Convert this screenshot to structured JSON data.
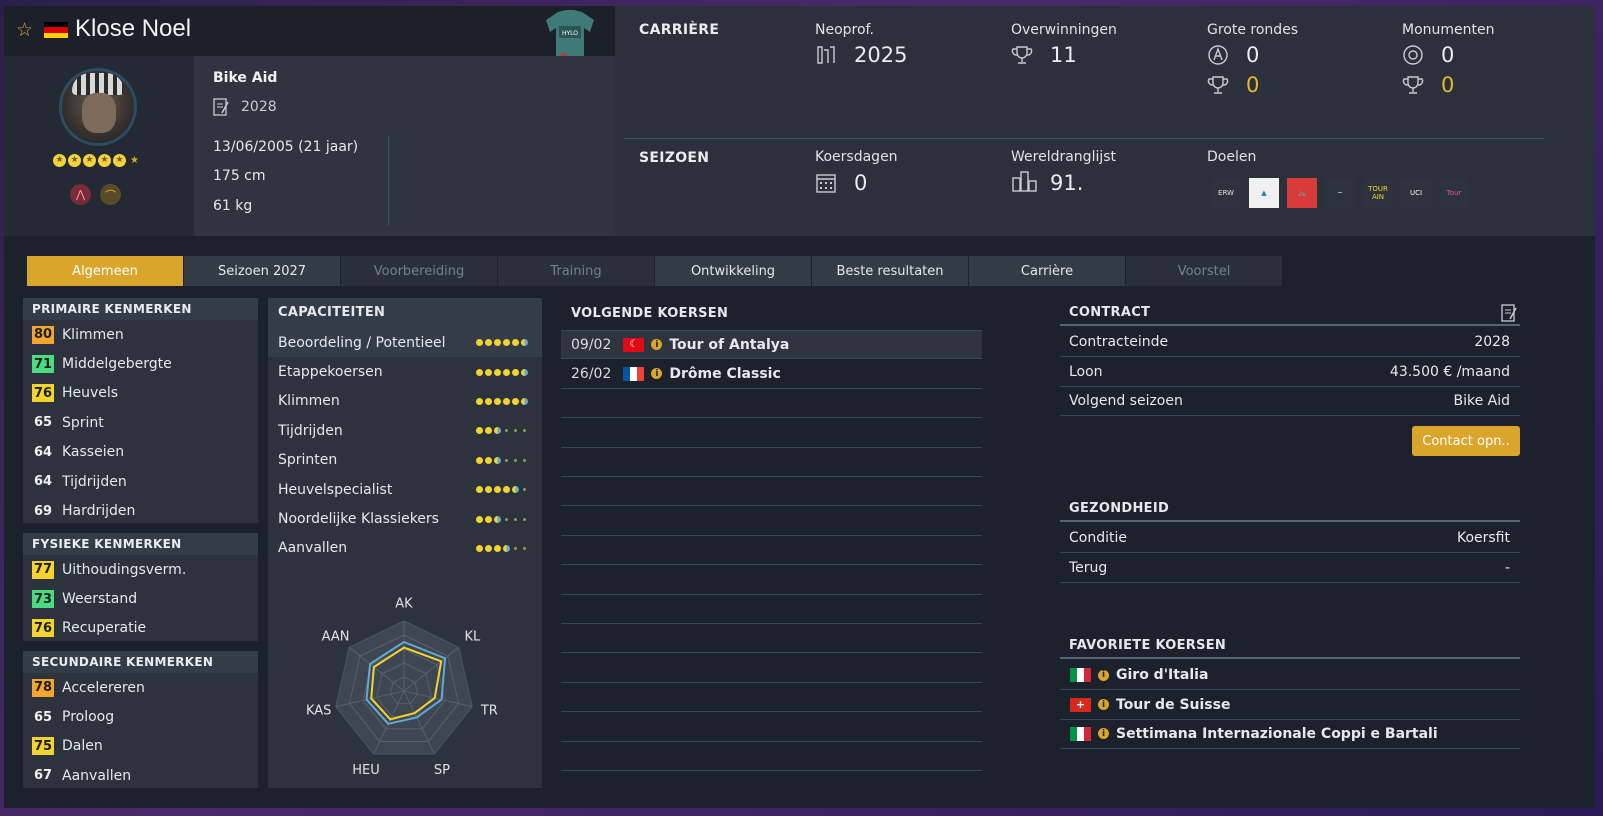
{
  "rider": {
    "name": "Klose Noel",
    "team": "Bike Aid",
    "contract_year": "2028",
    "birthdate": "13/06/2005 (21 jaar)",
    "height": "175 cm",
    "weight": "61 kg",
    "stars_full": 5,
    "stars_half": 1
  },
  "career": {
    "label": "CARRIÈRE",
    "neoprof_label": "Neoprof.",
    "neoprof_value": "2025",
    "wins_label": "Overwinningen",
    "wins_value": "11",
    "grand_tours_label": "Grote rondes",
    "grand_tours_starts": "0",
    "grand_tours_wins": "0",
    "monuments_label": "Monumenten",
    "monuments_starts": "0",
    "monuments_wins": "0"
  },
  "season": {
    "label": "SEIZOEN",
    "race_days_label": "Koersdagen",
    "race_days_value": "0",
    "ranking_label": "Wereldranglijst",
    "ranking_value": "91.",
    "goals_label": "Doelen",
    "goal_logos": [
      {
        "text": "ERW",
        "bg": "#2c333d",
        "color": "#e0e0e0"
      },
      {
        "text": "▲",
        "bg": "#f0f0f0",
        "color": "#1b7fb3"
      },
      {
        "text": "🚲",
        "bg": "#d93a3a",
        "color": "#fff"
      },
      {
        "text": "~",
        "bg": "#2c333d",
        "color": "#e0e0e0"
      },
      {
        "text": "TOUR AIN",
        "bg": "#2c333d",
        "color": "#f3d42e"
      },
      {
        "text": "UCI",
        "bg": "#2c333d",
        "color": "#fff"
      },
      {
        "text": "Tour",
        "bg": "#2c333d",
        "color": "#e05a8a"
      }
    ]
  },
  "tabs": [
    {
      "label": "Algemeen",
      "state": "active"
    },
    {
      "label": "Seizoen 2027",
      "state": "normal"
    },
    {
      "label": "Voorbereiding",
      "state": "disabled"
    },
    {
      "label": "Training",
      "state": "disabled"
    },
    {
      "label": "Ontwikkeling",
      "state": "normal"
    },
    {
      "label": "Beste resultaten",
      "state": "normal"
    },
    {
      "label": "Carrière",
      "state": "normal"
    },
    {
      "label": "Voorstel",
      "state": "disabled"
    }
  ],
  "primary": {
    "title": "PRIMAIRE KENMERKEN",
    "items": [
      {
        "value": "80",
        "label": "Klimmen",
        "tier": "o"
      },
      {
        "value": "71",
        "label": "Middelgebergte",
        "tier": "g"
      },
      {
        "value": "76",
        "label": "Heuvels",
        "tier": "y"
      },
      {
        "value": "65",
        "label": "Sprint",
        "tier": "plain"
      },
      {
        "value": "64",
        "label": "Kasseien",
        "tier": "plain"
      },
      {
        "value": "64",
        "label": "Tijdrijden",
        "tier": "plain"
      },
      {
        "value": "69",
        "label": "Hardrijden",
        "tier": "plain"
      }
    ]
  },
  "physical": {
    "title": "FYSIEKE KENMERKEN",
    "items": [
      {
        "value": "77",
        "label": "Uithoudingsverm.",
        "tier": "y"
      },
      {
        "value": "73",
        "label": "Weerstand",
        "tier": "g"
      },
      {
        "value": "76",
        "label": "Recuperatie",
        "tier": "y"
      }
    ]
  },
  "secondary": {
    "title": "SECUNDAIRE KENMERKEN",
    "items": [
      {
        "value": "78",
        "label": "Accelereren",
        "tier": "o"
      },
      {
        "value": "65",
        "label": "Proloog",
        "tier": "plain"
      },
      {
        "value": "75",
        "label": "Dalen",
        "tier": "y"
      },
      {
        "value": "67",
        "label": "Aanvallen",
        "tier": "plain"
      }
    ]
  },
  "capacities": {
    "title": "CAPACITEITEN",
    "items": [
      {
        "label": "Beoordeling / Potentieel",
        "full": 5,
        "half": 1,
        "faint": 0
      },
      {
        "label": "Etappekoersen",
        "full": 5,
        "half": 1,
        "faint": 0
      },
      {
        "label": "Klimmen",
        "full": 5,
        "half": 1,
        "faint": 0
      },
      {
        "label": "Tijdrijden",
        "full": 2,
        "half": 1,
        "faint": 3
      },
      {
        "label": "Sprinten",
        "full": 2,
        "half": 1,
        "faint": 3
      },
      {
        "label": "Heuvelspecialist",
        "full": 4,
        "half": 1,
        "faint": 1
      },
      {
        "label": "Noordelijke Klassiekers",
        "full": 2,
        "half": 1,
        "faint": 3
      },
      {
        "label": "Aanvallen",
        "full": 3,
        "half": 1,
        "faint": 2
      }
    ],
    "radar": {
      "axes": [
        "AK",
        "KL",
        "TR",
        "SP",
        "HEU",
        "KAS",
        "AAN"
      ],
      "potential": [
        0.7,
        0.75,
        0.55,
        0.42,
        0.52,
        0.55,
        0.62
      ],
      "current": [
        0.62,
        0.68,
        0.45,
        0.35,
        0.45,
        0.48,
        0.55
      ]
    }
  },
  "next_races": {
    "title": "VOLGENDE KOERSEN",
    "items": [
      {
        "date": "09/02",
        "flag": "tr",
        "name": "Tour of Antalya"
      },
      {
        "date": "26/02",
        "flag": "fr",
        "name": "Drôme Classic"
      }
    ],
    "empty_rows": 13
  },
  "contract": {
    "title": "CONTRACT",
    "rows": [
      {
        "label": "Contracteinde",
        "value": "2028"
      },
      {
        "label": "Loon",
        "value": "43.500 € /maand"
      },
      {
        "label": "Volgend seizoen",
        "value": "Bike Aid"
      }
    ],
    "button": "Contact opn.."
  },
  "health": {
    "title": "GEZONDHEID",
    "rows": [
      {
        "label": "Conditie",
        "value": "Koersfit"
      },
      {
        "label": "Terug",
        "value": "-"
      }
    ]
  },
  "favorites": {
    "title": "FAVORIETE KOERSEN",
    "items": [
      {
        "flag": "it",
        "name": "Giro d'Italia"
      },
      {
        "flag": "ch",
        "name": "Tour de Suisse"
      },
      {
        "flag": "it",
        "name": "Settimana Internazionale Coppi e Bartali"
      }
    ]
  },
  "colors": {
    "accent": "#d9a62b",
    "badge_yellow": "#f3d42e",
    "badge_orange": "#f2a72c",
    "badge_green": "#4bdc7d",
    "potential_line": "#62a9d4",
    "current_line": "#f3d42e"
  }
}
